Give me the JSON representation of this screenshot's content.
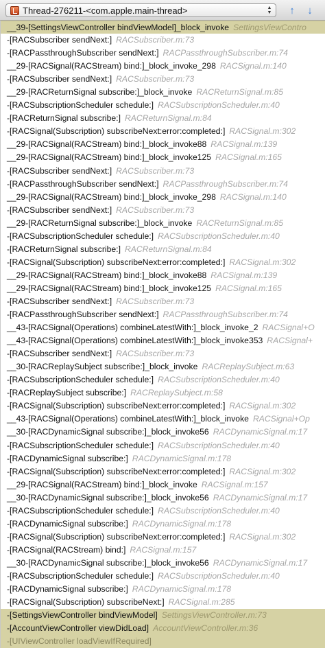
{
  "toolbar": {
    "thread_label": "Thread-276211-<com.apple.main-thread>",
    "thread_icon": "thread-icon",
    "prev_icon": "up-arrow",
    "next_icon": "down-arrow"
  },
  "frames": [
    {
      "symbol": "__39-[SettingsViewController bindViewModel]_block_invoke",
      "file": "SettingsViewContro"
    },
    {
      "symbol": "-[RACSubscriber sendNext:]",
      "file": "RACSubscriber.m:73"
    },
    {
      "symbol": "-[RACPassthroughSubscriber sendNext:]",
      "file": "RACPassthroughSubscriber.m:74"
    },
    {
      "symbol": "__29-[RACSignal(RACStream) bind:]_block_invoke_298",
      "file": "RACSignal.m:140"
    },
    {
      "symbol": "-[RACSubscriber sendNext:]",
      "file": "RACSubscriber.m:73"
    },
    {
      "symbol": "__29-[RACReturnSignal subscribe:]_block_invoke",
      "file": "RACReturnSignal.m:85"
    },
    {
      "symbol": "-[RACSubscriptionScheduler schedule:]",
      "file": "RACSubscriptionScheduler.m:40"
    },
    {
      "symbol": "-[RACReturnSignal subscribe:]",
      "file": "RACReturnSignal.m:84"
    },
    {
      "symbol": "-[RACSignal(Subscription) subscribeNext:error:completed:]",
      "file": "RACSignal.m:302"
    },
    {
      "symbol": "__29-[RACSignal(RACStream) bind:]_block_invoke88",
      "file": "RACSignal.m:139"
    },
    {
      "symbol": "__29-[RACSignal(RACStream) bind:]_block_invoke125",
      "file": "RACSignal.m:165"
    },
    {
      "symbol": "-[RACSubscriber sendNext:]",
      "file": "RACSubscriber.m:73"
    },
    {
      "symbol": "-[RACPassthroughSubscriber sendNext:]",
      "file": "RACPassthroughSubscriber.m:74"
    },
    {
      "symbol": "__29-[RACSignal(RACStream) bind:]_block_invoke_298",
      "file": "RACSignal.m:140"
    },
    {
      "symbol": "-[RACSubscriber sendNext:]",
      "file": "RACSubscriber.m:73"
    },
    {
      "symbol": "__29-[RACReturnSignal subscribe:]_block_invoke",
      "file": "RACReturnSignal.m:85"
    },
    {
      "symbol": "-[RACSubscriptionScheduler schedule:]",
      "file": "RACSubscriptionScheduler.m:40"
    },
    {
      "symbol": "-[RACReturnSignal subscribe:]",
      "file": "RACReturnSignal.m:84"
    },
    {
      "symbol": "-[RACSignal(Subscription) subscribeNext:error:completed:]",
      "file": "RACSignal.m:302"
    },
    {
      "symbol": "__29-[RACSignal(RACStream) bind:]_block_invoke88",
      "file": "RACSignal.m:139"
    },
    {
      "symbol": "__29-[RACSignal(RACStream) bind:]_block_invoke125",
      "file": "RACSignal.m:165"
    },
    {
      "symbol": "-[RACSubscriber sendNext:]",
      "file": "RACSubscriber.m:73"
    },
    {
      "symbol": "-[RACPassthroughSubscriber sendNext:]",
      "file": "RACPassthroughSubscriber.m:74"
    },
    {
      "symbol": "__43-[RACSignal(Operations) combineLatestWith:]_block_invoke_2",
      "file": "RACSignal+O"
    },
    {
      "symbol": "__43-[RACSignal(Operations) combineLatestWith:]_block_invoke353",
      "file": "RACSignal+"
    },
    {
      "symbol": "-[RACSubscriber sendNext:]",
      "file": "RACSubscriber.m:73"
    },
    {
      "symbol": "__30-[RACReplaySubject subscribe:]_block_invoke",
      "file": "RACReplaySubject.m:63"
    },
    {
      "symbol": "-[RACSubscriptionScheduler schedule:]",
      "file": "RACSubscriptionScheduler.m:40"
    },
    {
      "symbol": "-[RACReplaySubject subscribe:]",
      "file": "RACReplaySubject.m:58"
    },
    {
      "symbol": "-[RACSignal(Subscription) subscribeNext:error:completed:]",
      "file": "RACSignal.m:302"
    },
    {
      "symbol": "__43-[RACSignal(Operations) combineLatestWith:]_block_invoke",
      "file": "RACSignal+Op"
    },
    {
      "symbol": "__30-[RACDynamicSignal subscribe:]_block_invoke56",
      "file": "RACDynamicSignal.m:17"
    },
    {
      "symbol": "-[RACSubscriptionScheduler schedule:]",
      "file": "RACSubscriptionScheduler.m:40"
    },
    {
      "symbol": "-[RACDynamicSignal subscribe:]",
      "file": "RACDynamicSignal.m:178"
    },
    {
      "symbol": "-[RACSignal(Subscription) subscribeNext:error:completed:]",
      "file": "RACSignal.m:302"
    },
    {
      "symbol": "__29-[RACSignal(RACStream) bind:]_block_invoke",
      "file": "RACSignal.m:157"
    },
    {
      "symbol": "__30-[RACDynamicSignal subscribe:]_block_invoke56",
      "file": "RACDynamicSignal.m:17"
    },
    {
      "symbol": "-[RACSubscriptionScheduler schedule:]",
      "file": "RACSubscriptionScheduler.m:40"
    },
    {
      "symbol": "-[RACDynamicSignal subscribe:]",
      "file": "RACDynamicSignal.m:178"
    },
    {
      "symbol": "-[RACSignal(Subscription) subscribeNext:error:completed:]",
      "file": "RACSignal.m:302"
    },
    {
      "symbol": "-[RACSignal(RACStream) bind:]",
      "file": "RACSignal.m:157"
    },
    {
      "symbol": "__30-[RACDynamicSignal subscribe:]_block_invoke56",
      "file": "RACDynamicSignal.m:17"
    },
    {
      "symbol": "-[RACSubscriptionScheduler schedule:]",
      "file": "RACSubscriptionScheduler.m:40"
    },
    {
      "symbol": "-[RACDynamicSignal subscribe:]",
      "file": "RACDynamicSignal.m:178"
    },
    {
      "symbol": "-[RACSignal(Subscription) subscribeNext:]",
      "file": "RACSignal.m:285"
    },
    {
      "symbol": "-[SettingsViewController bindViewModel]",
      "file": "SettingsViewController.m:73"
    },
    {
      "symbol": "-[AccountViewController viewDidLoad]",
      "file": "AccountViewController.m:36"
    },
    {
      "symbol": "-[UIViewController loadViewIfRequired]",
      "file": ""
    }
  ]
}
